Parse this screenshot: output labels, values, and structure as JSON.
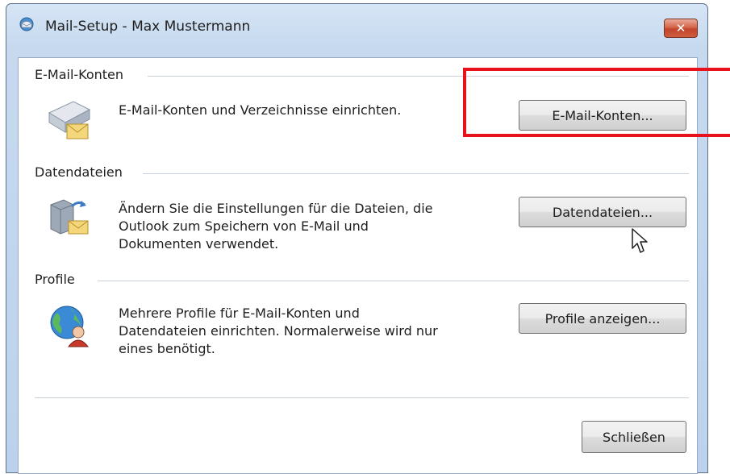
{
  "window": {
    "title": "Mail-Setup - Max Mustermann",
    "close_label": "✕"
  },
  "sections": {
    "accounts": {
      "heading": "E-Mail-Konten",
      "description_lines": [
        "E-Mail-Konten und Verzeichnisse einrichten."
      ],
      "button_label": "E-Mail-Konten..."
    },
    "datafiles": {
      "heading": "Datendateien",
      "description_lines": [
        "Ändern Sie die Einstellungen für die Dateien, die",
        "Outlook zum Speichern von E-Mail und",
        "Dokumenten verwendet."
      ],
      "button_label": "Datendateien..."
    },
    "profiles": {
      "heading": "Profile",
      "description_lines": [
        "Mehrere Profile für E-Mail-Konten und",
        "Datendateien einrichten. Normalerweise wird nur",
        "eines benötigt."
      ],
      "button_label": "Profile anzeigen..."
    }
  },
  "footer": {
    "close_button_label": "Schließen"
  },
  "colors": {
    "highlight": "#e8121c",
    "window_frame": "#c6d9ef"
  },
  "icons": {
    "title": "mail-setup-icon",
    "accounts": "email-accounts-icon",
    "datafiles": "data-files-icon",
    "profiles": "profiles-icon",
    "pointer": "mouse-pointer-icon"
  }
}
